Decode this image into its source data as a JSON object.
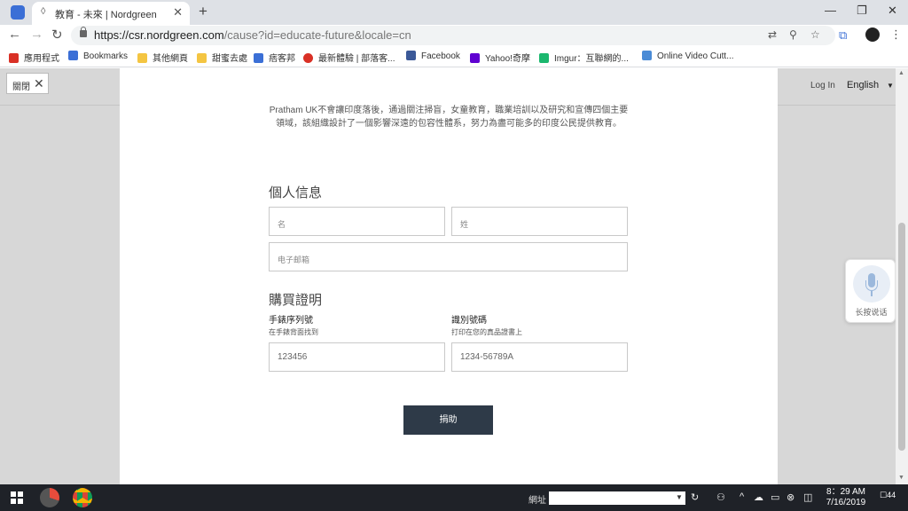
{
  "browser": {
    "tab_title": "教育 - 未來 | Nordgreen",
    "url_host": "https://csr.nordgreen.com",
    "url_path": "/cause?id=educate-future&locale=cn",
    "bookmarks": [
      {
        "label": "應用程式",
        "color": "#d93025"
      },
      {
        "label": "Bookmarks",
        "color": "#3b6fd6"
      },
      {
        "label": "其他網頁",
        "color": "#f4c542"
      },
      {
        "label": "甜蜜去處",
        "color": "#f4c542"
      },
      {
        "label": "痞客邦",
        "color": "#3b6fd6"
      },
      {
        "label": "最新體驗 | 部落客...",
        "color": "#d93025"
      },
      {
        "label": "Facebook",
        "color": "#3b5998"
      },
      {
        "label": "Yahoo!奇摩",
        "color": "#5f01d1"
      },
      {
        "label": "Imgur：互聯網的...",
        "color": "#1bb76e"
      },
      {
        "label": "Online Video Cutt...",
        "color": "#4a8bd6"
      }
    ]
  },
  "page": {
    "close_chip": "關閉",
    "login": "Log In",
    "language": "English",
    "intro_line1": "Pratham UK不會讓印度落後，通過關注掃盲，女童教育，職業培訓以及研究和宣傳四個主要",
    "intro_line2": "領域，該組織設計了一個影響深遠的包容性體系，努力為盡可能多的印度公民提供教育。",
    "personal_title": "個人信息",
    "first_name_placeholder": "名",
    "last_name_placeholder": "姓",
    "email_placeholder": "电子邮箱",
    "purchase_title": "購買證明",
    "serial_label": "手錶序列號",
    "serial_hint": "在手錶背面找到",
    "id_label": "識別號碼",
    "id_hint": "打印在您的真品證書上",
    "serial_example": "123456",
    "id_example": "1234-56789A",
    "donate_button": "捐助",
    "voice_label": "长按说话"
  },
  "taskbar": {
    "address_label": "網址",
    "time": "8：29 AM",
    "date": "7/16/2019",
    "notifications": "44"
  }
}
